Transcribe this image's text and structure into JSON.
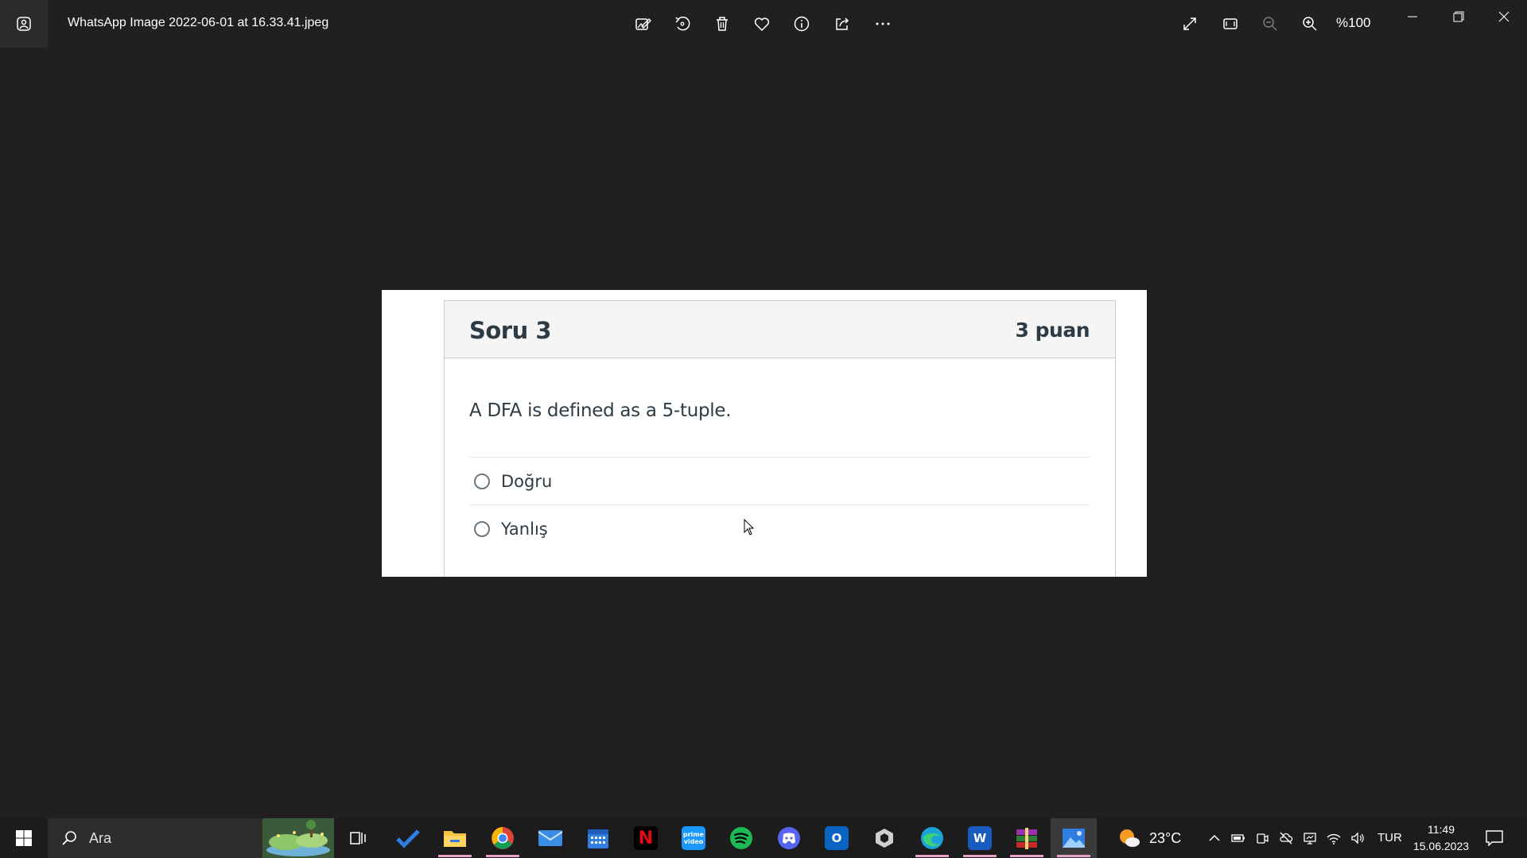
{
  "window": {
    "title": "WhatsApp Image 2022-06-01 at 16.33.41.jpeg",
    "zoom": "%100",
    "toolbar_icons": [
      "edit-image-icon",
      "rotate-icon",
      "delete-icon",
      "favorite-icon",
      "info-icon",
      "share-icon",
      "more-icon"
    ],
    "view_icons": [
      "fullscreen-icon",
      "fit-to-window-icon",
      "zoom-out-icon",
      "zoom-in-icon"
    ]
  },
  "photo": {
    "question_title": "Soru 3",
    "points": "3 puan",
    "question_text": "A DFA is defined as a 5-tuple.",
    "answers": [
      {
        "label": "Doğru",
        "selected": false
      },
      {
        "label": "Yanlış",
        "selected": false
      }
    ]
  },
  "taskbar": {
    "search_placeholder": "Ara",
    "apps": [
      "task-view",
      "todo",
      "file-explorer",
      "chrome",
      "mail",
      "calendar",
      "netflix",
      "prime-video",
      "spotify",
      "discord",
      "outlook",
      "unity",
      "edge",
      "word",
      "winrar",
      "photos"
    ],
    "prime_label": "prime video",
    "netflix_label": "N",
    "word_label": "W",
    "outlook_label": "O",
    "weather_temp": "23°C",
    "language": "TUR",
    "time": "11:49",
    "date": "15.06.2023",
    "colors": {
      "accent_running": "#e8a0c8",
      "taskbar_bg": "#1c1c1c"
    }
  }
}
